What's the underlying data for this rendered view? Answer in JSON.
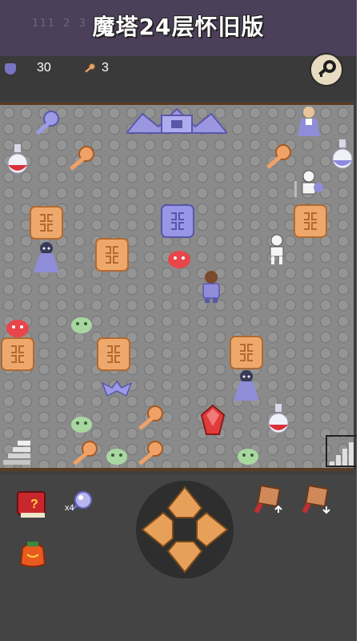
{
  "title": "魔塔24层怀旧版",
  "title_ghost": "111 2 3 4",
  "status": {
    "defense": "30",
    "keys": "3"
  },
  "inventory": {
    "orb_count": "x4"
  },
  "colors": {
    "frame": "#4c3f5a",
    "floor": "#8a8a8a",
    "border": "#5a3b22",
    "blue_door": "#8d8ae0",
    "yellow_door": "#e3a36a"
  },
  "board": {
    "entities": [
      {
        "name": "blue-key-icon",
        "kind": "key-blue"
      },
      {
        "name": "stone-gate-icon",
        "kind": "gate"
      },
      {
        "name": "old-man-npc-icon",
        "kind": "npc"
      },
      {
        "name": "red-potion-icon",
        "kind": "potion-red"
      },
      {
        "name": "yellow-key-icon",
        "kind": "key-yellow"
      },
      {
        "name": "yellow-key-icon",
        "kind": "key-yellow"
      },
      {
        "name": "blue-potion-icon",
        "kind": "potion-blue"
      },
      {
        "name": "skeleton-soldier-icon",
        "kind": "skeleton"
      },
      {
        "name": "yellow-door-icon",
        "kind": "door-yellow"
      },
      {
        "name": "blue-door-icon",
        "kind": "door-blue"
      },
      {
        "name": "yellow-door-icon",
        "kind": "door-yellow"
      },
      {
        "name": "dark-priest-icon",
        "kind": "priest"
      },
      {
        "name": "yellow-door-icon",
        "kind": "door-yellow"
      },
      {
        "name": "red-slime-icon",
        "kind": "slime-red"
      },
      {
        "name": "skeleton-icon",
        "kind": "skeleton"
      },
      {
        "name": "hero-icon",
        "kind": "hero"
      },
      {
        "name": "red-slime-icon",
        "kind": "slime-red"
      },
      {
        "name": "green-slime-icon",
        "kind": "slime-green"
      },
      {
        "name": "yellow-door-icon",
        "kind": "door-yellow"
      },
      {
        "name": "yellow-door-icon",
        "kind": "door-yellow"
      },
      {
        "name": "yellow-door-icon",
        "kind": "door-yellow"
      },
      {
        "name": "bat-icon",
        "kind": "bat"
      },
      {
        "name": "dark-priest-icon",
        "kind": "priest"
      },
      {
        "name": "green-slime-icon",
        "kind": "slime-green"
      },
      {
        "name": "yellow-key-icon",
        "kind": "key-yellow"
      },
      {
        "name": "red-gem-icon",
        "kind": "gem"
      },
      {
        "name": "red-potion-icon",
        "kind": "potion-red"
      },
      {
        "name": "stairs-down-icon",
        "kind": "stairs"
      },
      {
        "name": "yellow-key-icon",
        "kind": "key-yellow"
      },
      {
        "name": "green-slime-icon",
        "kind": "slime-green"
      },
      {
        "name": "yellow-key-icon",
        "kind": "key-yellow"
      },
      {
        "name": "green-slime-icon",
        "kind": "slime-green"
      },
      {
        "name": "stairs-up-icon",
        "kind": "stairs"
      }
    ]
  },
  "controls": {
    "items": [
      "monster-book-icon",
      "orb-icon",
      "treasure-bag-icon",
      "fly-up-icon",
      "fly-down-icon"
    ],
    "dpad": [
      "up-arrow",
      "left-arrow",
      "right-arrow",
      "down-arrow"
    ]
  }
}
